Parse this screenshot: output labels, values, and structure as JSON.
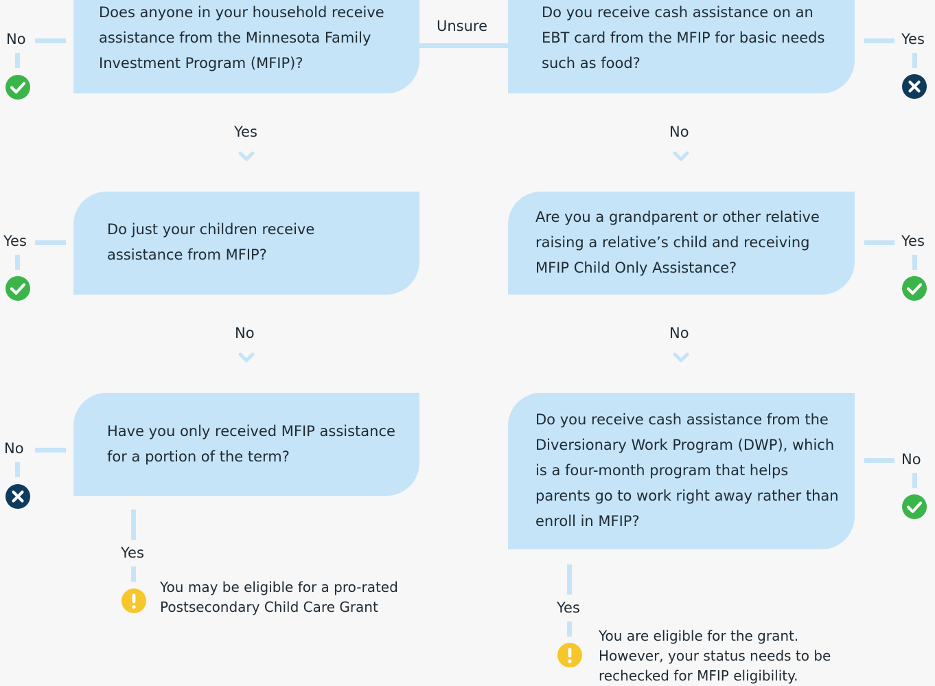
{
  "questions": {
    "q1": "Does anyone in your household receive assistance from the Minnesota Family Investment Program (MFIP)?",
    "q2": "Do you receive cash assistance on an EBT card from the MFIP for basic needs such as food?",
    "q3": "Do just your children receive assistance from MFIP?",
    "q4": "Are you a grandparent or other relative raising a relative’s child and receiving MFIP Child Only Assistance?",
    "q5": "Have you only received MFIP assistance for a portion of the term?",
    "q6": "Do you receive cash assistance from the Diversionary Work Program (DWP), which is a four-month program that helps parents go to work right away rather than enroll in MFIP?"
  },
  "labels": {
    "unsure": "Unsure",
    "q1_side": "No",
    "q1_down": "Yes",
    "q2_side": "Yes",
    "q2_down": "No",
    "q3_side": "Yes",
    "q3_down": "No",
    "q4_side": "Yes",
    "q4_down": "No",
    "q5_side": "No",
    "q5_down": "Yes",
    "q6_side": "No",
    "q6_down": "Yes"
  },
  "outcomes": {
    "q1_side": "check-icon",
    "q2_side": "x-icon",
    "q3_side": "check-icon",
    "q4_side": "check-icon",
    "q5_side": "x-icon",
    "q6_side": "check-icon",
    "q5_down": "warning-icon",
    "q6_down": "warning-icon"
  },
  "notes": {
    "q5_line1": "You may be eligible for a pro-rated",
    "q5_line2": "Postsecondary Child Care Grant",
    "q6_line1": "You are eligible for the grant.",
    "q6_line2": "However, your status needs to be",
    "q6_line3": "rechecked for MFIP eligibility."
  },
  "colors": {
    "box": "#c5e4f7",
    "connector": "#c5e4f7",
    "check": "#3bb54a",
    "x": "#0e3a5c",
    "warning": "#f6c62a"
  }
}
